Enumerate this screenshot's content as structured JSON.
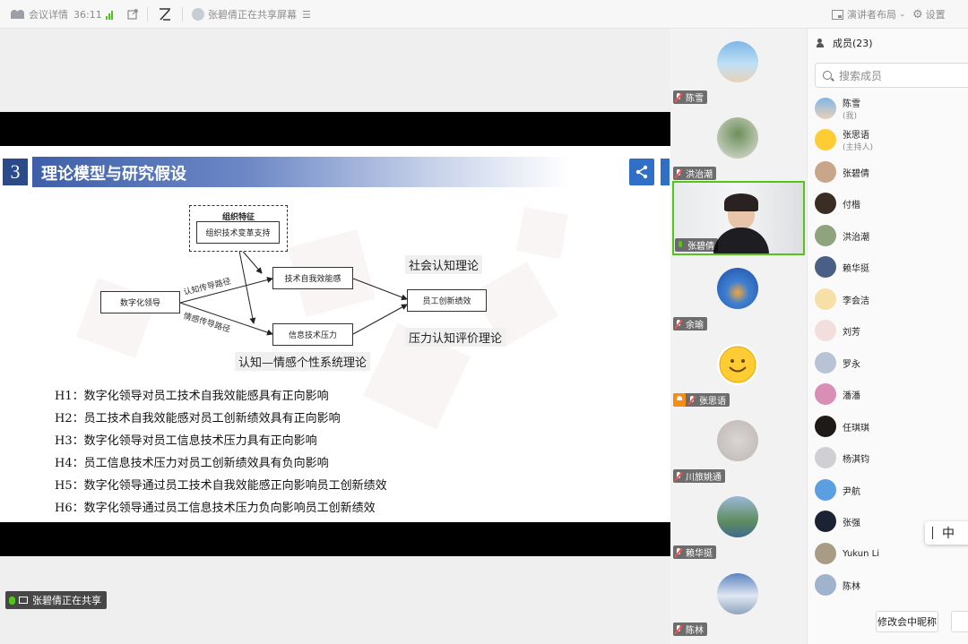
{
  "topbar": {
    "meeting_details": "会议详情",
    "timer": "36:11",
    "sharing_status": "张碧倩正在共享屏幕",
    "presenter_layout": "演讲者布局",
    "settings": "设置"
  },
  "slide": {
    "number": "3",
    "title": "理论模型与研究假设",
    "diagram": {
      "org_group_label": "组织特征",
      "org_support": "组织技术变革支持",
      "leadership": "数字化领导",
      "self_efficacy": "技术自我效能感",
      "techno_stress": "信息技术压力",
      "innovation": "员工创新绩效",
      "path_cognitive": "认知传导路径",
      "path_emotional": "情感传导路径",
      "theory_social": "社会认知理论",
      "theory_stress": "压力认知评价理论",
      "theory_cape": "认知—情感个性系统理论"
    },
    "hypotheses": [
      "H1：数字化领导对员工技术自我效能感具有正向影响",
      "H2：员工技术自我效能感对员工创新绩效具有正向影响",
      "H3：数字化领导对员工信息技术压力具有正向影响",
      "H4：员工信息技术压力对员工创新绩效具有负向影响",
      "H5：数字化领导通过员工技术自我效能感正向影响员工创新绩效",
      "H6：数字化领导通过员工信息技术压力负向影响员工创新绩效"
    ]
  },
  "sharing_tag": "张碧倩正在共享",
  "video_tiles": [
    {
      "name": "陈雪"
    },
    {
      "name": "洪治潮"
    },
    {
      "name": "张碧倩"
    },
    {
      "name": "余瑜"
    },
    {
      "name": "张思语"
    },
    {
      "name": "川旅姚通"
    },
    {
      "name": "赖华挺"
    },
    {
      "name": "陈林"
    }
  ],
  "members": {
    "header": "成员(23)",
    "search_placeholder": "搜索成员",
    "list": [
      {
        "name": "陈雪",
        "sub": "(我)"
      },
      {
        "name": "张思语",
        "sub": "(主持人)"
      },
      {
        "name": "张碧倩",
        "sub": ""
      },
      {
        "name": "付楷",
        "sub": ""
      },
      {
        "name": "洪治潮",
        "sub": ""
      },
      {
        "name": "赖华挺",
        "sub": ""
      },
      {
        "name": "李会洁",
        "sub": ""
      },
      {
        "name": "刘芳",
        "sub": ""
      },
      {
        "name": "罗永",
        "sub": ""
      },
      {
        "name": "潘潘",
        "sub": ""
      },
      {
        "name": "任琪琪",
        "sub": ""
      },
      {
        "name": "杨淇钧",
        "sub": ""
      },
      {
        "name": "尹航",
        "sub": ""
      },
      {
        "name": "张强",
        "sub": ""
      },
      {
        "name": "Yukun Li",
        "sub": ""
      },
      {
        "name": "陈林",
        "sub": ""
      }
    ],
    "rename_button": "修改会中昵称"
  },
  "ime": {
    "mode": "中"
  }
}
